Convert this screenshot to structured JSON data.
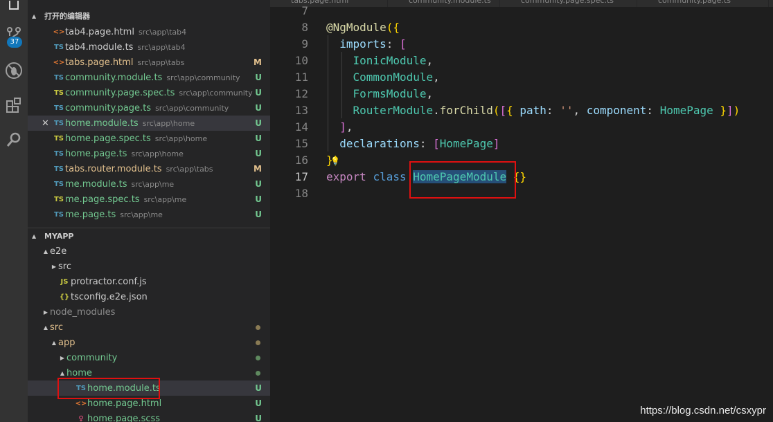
{
  "activity_bar": {
    "scm_badge": "37"
  },
  "open_editors": {
    "header": "打开的编辑器",
    "items": [
      {
        "icon": "<>",
        "icon_color": "#e37933",
        "name": "tab4.page.html",
        "path": "src\\app\\tab4",
        "status": ""
      },
      {
        "icon": "TS",
        "icon_color": "#519aba",
        "name": "tab4.module.ts",
        "path": "src\\app\\tab4",
        "status": ""
      },
      {
        "icon": "<>",
        "icon_color": "#e37933",
        "name": "tabs.page.html",
        "path": "src\\app\\tabs",
        "status": "M",
        "name_color": "#e2c08d"
      },
      {
        "icon": "TS",
        "icon_color": "#519aba",
        "name": "community.module.ts",
        "path": "src\\app\\community",
        "status": "U",
        "name_color": "#73c991"
      },
      {
        "icon": "TS",
        "icon_color": "#cbcb41",
        "name": "community.page.spec.ts",
        "path": "src\\app\\community",
        "status": "U",
        "name_color": "#73c991"
      },
      {
        "icon": "TS",
        "icon_color": "#519aba",
        "name": "community.page.ts",
        "path": "src\\app\\community",
        "status": "U",
        "name_color": "#73c991"
      },
      {
        "icon": "TS",
        "icon_color": "#519aba",
        "name": "home.module.ts",
        "path": "src\\app\\home",
        "status": "U",
        "name_color": "#73c991",
        "selected": true
      },
      {
        "icon": "TS",
        "icon_color": "#cbcb41",
        "name": "home.page.spec.ts",
        "path": "src\\app\\home",
        "status": "U",
        "name_color": "#73c991"
      },
      {
        "icon": "TS",
        "icon_color": "#519aba",
        "name": "home.page.ts",
        "path": "src\\app\\home",
        "status": "U",
        "name_color": "#73c991"
      },
      {
        "icon": "TS",
        "icon_color": "#519aba",
        "name": "tabs.router.module.ts",
        "path": "src\\app\\tabs",
        "status": "M",
        "name_color": "#e2c08d"
      },
      {
        "icon": "TS",
        "icon_color": "#519aba",
        "name": "me.module.ts",
        "path": "src\\app\\me",
        "status": "U",
        "name_color": "#73c991"
      },
      {
        "icon": "TS",
        "icon_color": "#cbcb41",
        "name": "me.page.spec.ts",
        "path": "src\\app\\me",
        "status": "U",
        "name_color": "#73c991"
      },
      {
        "icon": "TS",
        "icon_color": "#519aba",
        "name": "me.page.ts",
        "path": "src\\app\\me",
        "status": "U",
        "name_color": "#73c991"
      }
    ]
  },
  "explorer": {
    "header": "MYAPP",
    "items": [
      {
        "indent": 1,
        "chev": "▲",
        "icon": "",
        "name": "e2e",
        "color": "#cccccc"
      },
      {
        "indent": 2,
        "chev": "▶",
        "icon": "",
        "name": "src",
        "color": "#cccccc"
      },
      {
        "indent": 2,
        "chev": "",
        "icon": "JS",
        "icon_color": "#cbcb41",
        "name": "protractor.conf.js",
        "color": "#cccccc"
      },
      {
        "indent": 2,
        "chev": "",
        "icon": "{}",
        "icon_color": "#cbcb41",
        "name": "tsconfig.e2e.json",
        "color": "#cccccc"
      },
      {
        "indent": 1,
        "chev": "▶",
        "icon": "",
        "name": "node_modules",
        "color": "#8c8c8c"
      },
      {
        "indent": 1,
        "chev": "▲",
        "icon": "",
        "name": "src",
        "color": "#e2c08d",
        "dot": "y"
      },
      {
        "indent": 2,
        "chev": "▲",
        "icon": "",
        "name": "app",
        "color": "#e2c08d",
        "dot": "y"
      },
      {
        "indent": 3,
        "chev": "▶",
        "icon": "",
        "name": "community",
        "color": "#73c991",
        "dot": "g"
      },
      {
        "indent": 3,
        "chev": "▲",
        "icon": "",
        "name": "home",
        "color": "#73c991",
        "dot": "g"
      },
      {
        "indent": 4,
        "chev": "",
        "icon": "TS",
        "icon_color": "#519aba",
        "name": "home.module.ts",
        "color": "#73c991",
        "status": "U",
        "selected": true
      },
      {
        "indent": 4,
        "chev": "",
        "icon": "<>",
        "icon_color": "#e37933",
        "name": "home.page.html",
        "color": "#73c991",
        "status": "U"
      },
      {
        "indent": 4,
        "chev": "",
        "icon": "♀",
        "icon_color": "#f55385",
        "name": "home.page.scss",
        "color": "#73c991",
        "status": "U"
      }
    ]
  },
  "tabs": [
    "tabs.page.html",
    "community.module.ts",
    "community.page.spec.ts",
    "community.page.ts"
  ],
  "editor": {
    "lines": [
      {
        "n": "7",
        "t": ""
      },
      {
        "n": "8",
        "t": "@NgModule({"
      },
      {
        "n": "9",
        "t": "  imports: ["
      },
      {
        "n": "10",
        "t": "    IonicModule,"
      },
      {
        "n": "11",
        "t": "    CommonModule,"
      },
      {
        "n": "12",
        "t": "    FormsModule,"
      },
      {
        "n": "13",
        "t": "    RouterModule.forChild([{ path: '', component: HomePage }])"
      },
      {
        "n": "14",
        "t": "  ],"
      },
      {
        "n": "15",
        "t": "  declarations: [HomePage]"
      },
      {
        "n": "16",
        "t": "})"
      },
      {
        "n": "17",
        "t": "export class HomePageModule {}"
      },
      {
        "n": "18",
        "t": ""
      }
    ],
    "current_line": "17"
  },
  "watermark": "https://blog.csdn.net/csxypr"
}
